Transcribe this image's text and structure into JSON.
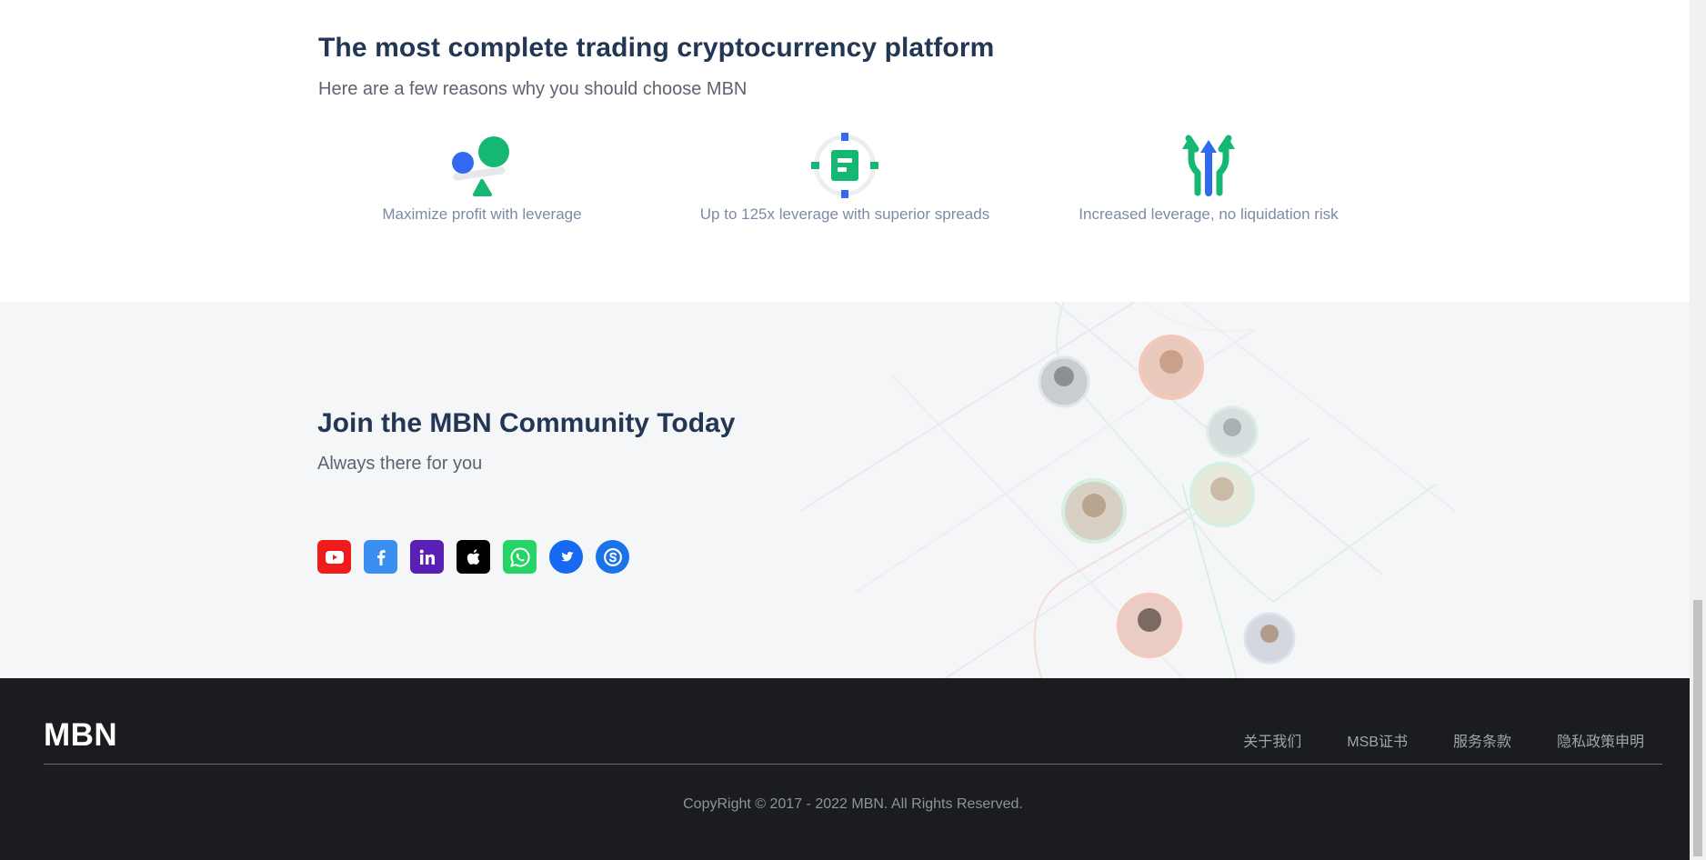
{
  "features": {
    "title": "The most complete trading cryptocurrency platform",
    "subtitle": "Here are a few reasons why you should choose MBN",
    "items": [
      {
        "icon": "balance-shapes-icon",
        "caption": "Maximize profit with leverage"
      },
      {
        "icon": "target-document-icon",
        "caption": "Up to 125x leverage with superior spreads"
      },
      {
        "icon": "three-arrows-up-icon",
        "caption": "Increased leverage, no liquidation risk"
      }
    ]
  },
  "community": {
    "title": "Join the MBN Community Today",
    "subtitle": "Always there for you",
    "social": [
      {
        "name": "youtube",
        "color": "#ee1c1c"
      },
      {
        "name": "facebook",
        "color": "#3b8ff0"
      },
      {
        "name": "linkedin",
        "color": "#5a1fb5"
      },
      {
        "name": "apple",
        "color": "#000000"
      },
      {
        "name": "whatsapp",
        "color": "#25d366"
      },
      {
        "name": "twitter",
        "color": "#1669f0"
      },
      {
        "name": "skype",
        "color": "#1a73e8"
      }
    ]
  },
  "footer": {
    "logo": "MBN",
    "links": [
      "关于我们",
      "MSB证书",
      "服务条款",
      "隐私政策申明"
    ],
    "copyright": "CopyRight © 2017 - 2022 MBN. All Rights Reserved."
  },
  "colors": {
    "heading": "#233755",
    "green": "#15b872",
    "blue": "#2f6af0",
    "footer_bg": "#1b1c20",
    "community_bg": "#f5f6f8"
  }
}
